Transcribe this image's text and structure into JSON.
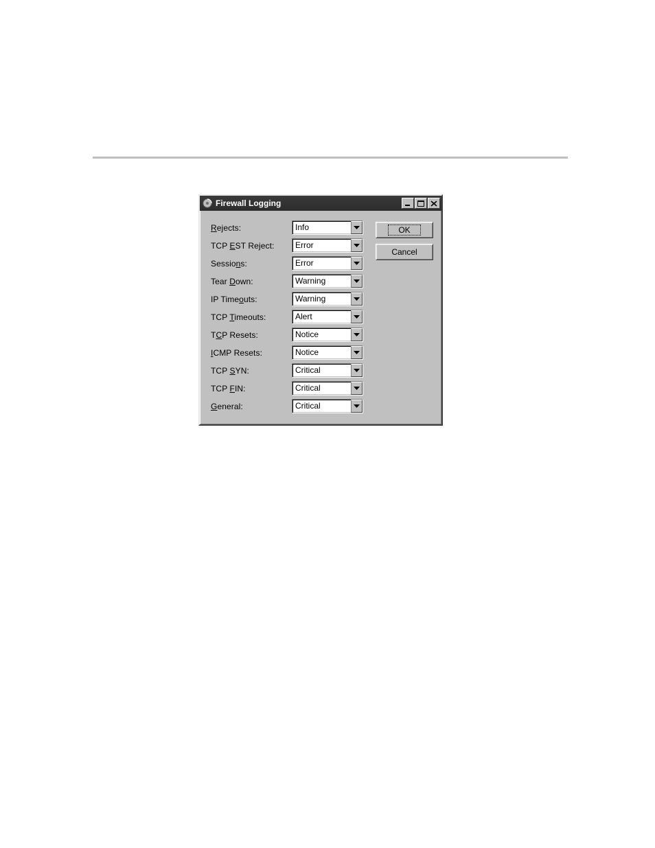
{
  "window": {
    "title": "Firewall Logging",
    "buttons": {
      "ok": "OK",
      "cancel": "Cancel"
    }
  },
  "fields": [
    {
      "id": "rejects",
      "label_pre": "",
      "label_u": "R",
      "label_post": "ejects:",
      "value": "Info"
    },
    {
      "id": "tcp-est-reject",
      "label_pre": "TCP ",
      "label_u": "E",
      "label_post": "ST Reject:",
      "value": "Error"
    },
    {
      "id": "sessions",
      "label_pre": "Sessio",
      "label_u": "n",
      "label_post": "s:",
      "value": "Error"
    },
    {
      "id": "tear-down",
      "label_pre": "Tear ",
      "label_u": "D",
      "label_post": "own:",
      "value": "Warning"
    },
    {
      "id": "ip-timeouts",
      "label_pre": "IP Time",
      "label_u": "o",
      "label_post": "uts:",
      "value": "Warning"
    },
    {
      "id": "tcp-timeouts",
      "label_pre": "TCP ",
      "label_u": "T",
      "label_post": "imeouts:",
      "value": "Alert"
    },
    {
      "id": "tcp-resets",
      "label_pre": "T",
      "label_u": "C",
      "label_post": "P Resets:",
      "value": "Notice"
    },
    {
      "id": "icmp-resets",
      "label_pre": "",
      "label_u": "I",
      "label_post": "CMP Resets:",
      "value": "Notice"
    },
    {
      "id": "tcp-syn",
      "label_pre": "TCP ",
      "label_u": "S",
      "label_post": "YN:",
      "value": "Critical"
    },
    {
      "id": "tcp-fin",
      "label_pre": "TCP ",
      "label_u": "F",
      "label_post": "IN:",
      "value": "Critical"
    },
    {
      "id": "general",
      "label_pre": "",
      "label_u": "G",
      "label_post": "eneral:",
      "value": "Critical"
    }
  ]
}
